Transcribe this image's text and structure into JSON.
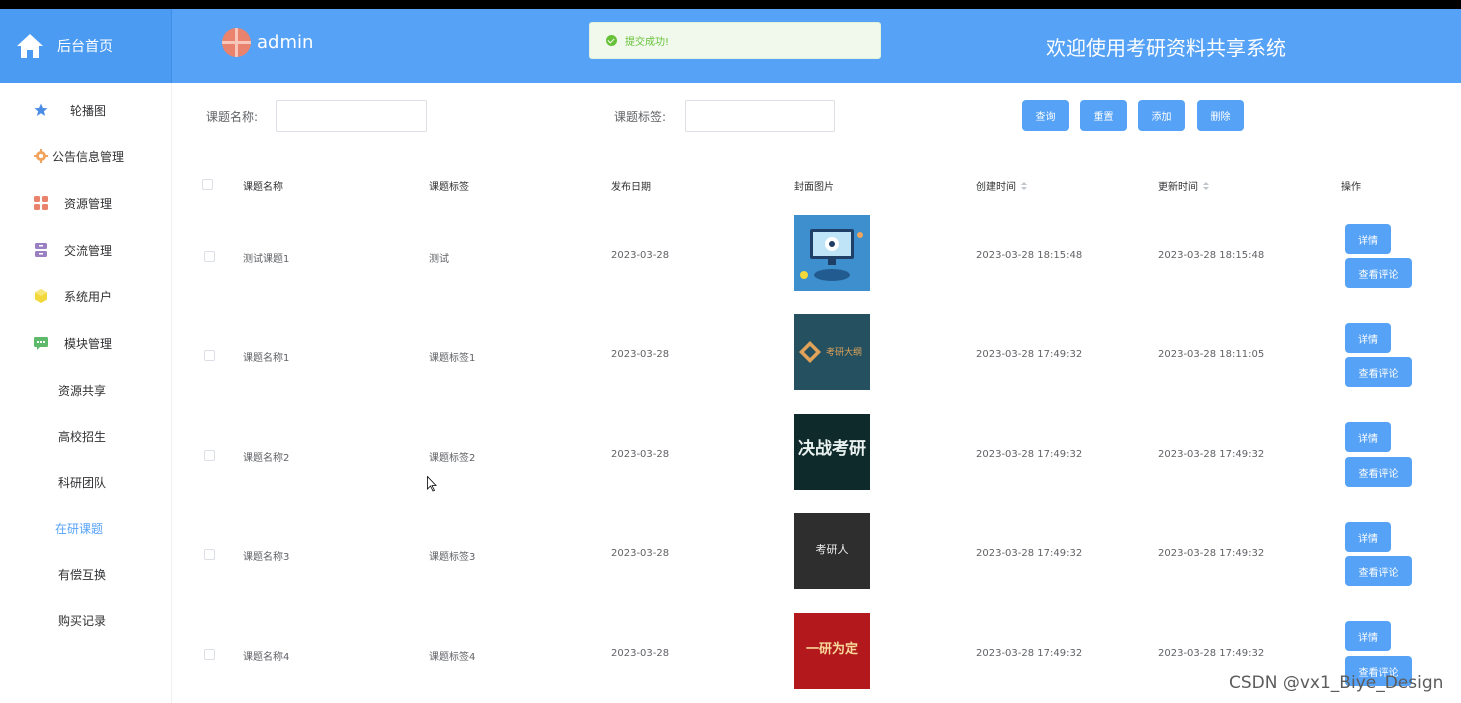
{
  "header": {
    "home_label": "后台首页",
    "username": "admin",
    "toast": "提交成功!",
    "site_title": "欢迎使用考研资料共享系统",
    "colors": {
      "brand": "#56a2f6",
      "success": "#67c23a"
    }
  },
  "sidebar": {
    "items": [
      {
        "label": "轮播图",
        "icon": "star-icon",
        "color": "#4b8de6"
      },
      {
        "label": "公告信息管理",
        "icon": "gear-icon",
        "color": "#f0a45d"
      },
      {
        "label": "资源管理",
        "icon": "grid-icon",
        "color": "#e9836d"
      },
      {
        "label": "交流管理",
        "icon": "archive-icon",
        "color": "#9a7fc3"
      },
      {
        "label": "系统用户",
        "icon": "cube-icon",
        "color": "#f2d83a"
      },
      {
        "label": "模块管理",
        "icon": "chat-icon",
        "color": "#5fb96a"
      }
    ],
    "sub_items": [
      {
        "label": "资源共享"
      },
      {
        "label": "高校招生"
      },
      {
        "label": "科研团队"
      },
      {
        "label": "在研课题",
        "active": true
      },
      {
        "label": "有偿互换"
      },
      {
        "label": "购买记录"
      }
    ]
  },
  "search": {
    "name_label": "课题名称:",
    "name_value": "",
    "tag_label": "课题标签:",
    "tag_value": "",
    "buttons": {
      "query": "查询",
      "reset": "重置",
      "add": "添加",
      "delete": "删除"
    }
  },
  "table": {
    "columns": [
      "课题名称",
      "课题标签",
      "发布日期",
      "封面图片",
      "创建时间",
      "更新时间",
      "操作"
    ],
    "rows": [
      {
        "name": "测试课题1",
        "tag": "测试",
        "date": "2023-03-28",
        "created": "2023-03-28 18:15:48",
        "updated": "2023-03-28 18:15:48",
        "cover_text": ""
      },
      {
        "name": "课题名称1",
        "tag": "课题标签1",
        "date": "2023-03-28",
        "created": "2023-03-28 17:49:32",
        "updated": "2023-03-28 18:11:05",
        "cover_text": "考研大纲"
      },
      {
        "name": "课题名称2",
        "tag": "课题标签2",
        "date": "2023-03-28",
        "created": "2023-03-28 17:49:32",
        "updated": "2023-03-28 17:49:32",
        "cover_text": "决战考研"
      },
      {
        "name": "课题名称3",
        "tag": "课题标签3",
        "date": "2023-03-28",
        "created": "2023-03-28 17:49:32",
        "updated": "2023-03-28 17:49:32",
        "cover_text": "考研人"
      },
      {
        "name": "课题名称4",
        "tag": "课题标签4",
        "date": "2023-03-28",
        "created": "2023-03-28 17:49:32",
        "updated": "2023-03-28 17:49:32",
        "cover_text": "一研为定"
      }
    ],
    "row_actions": {
      "detail": "详情",
      "comments": "查看评论"
    }
  },
  "watermark": "CSDN @vx1_Biye_Design"
}
